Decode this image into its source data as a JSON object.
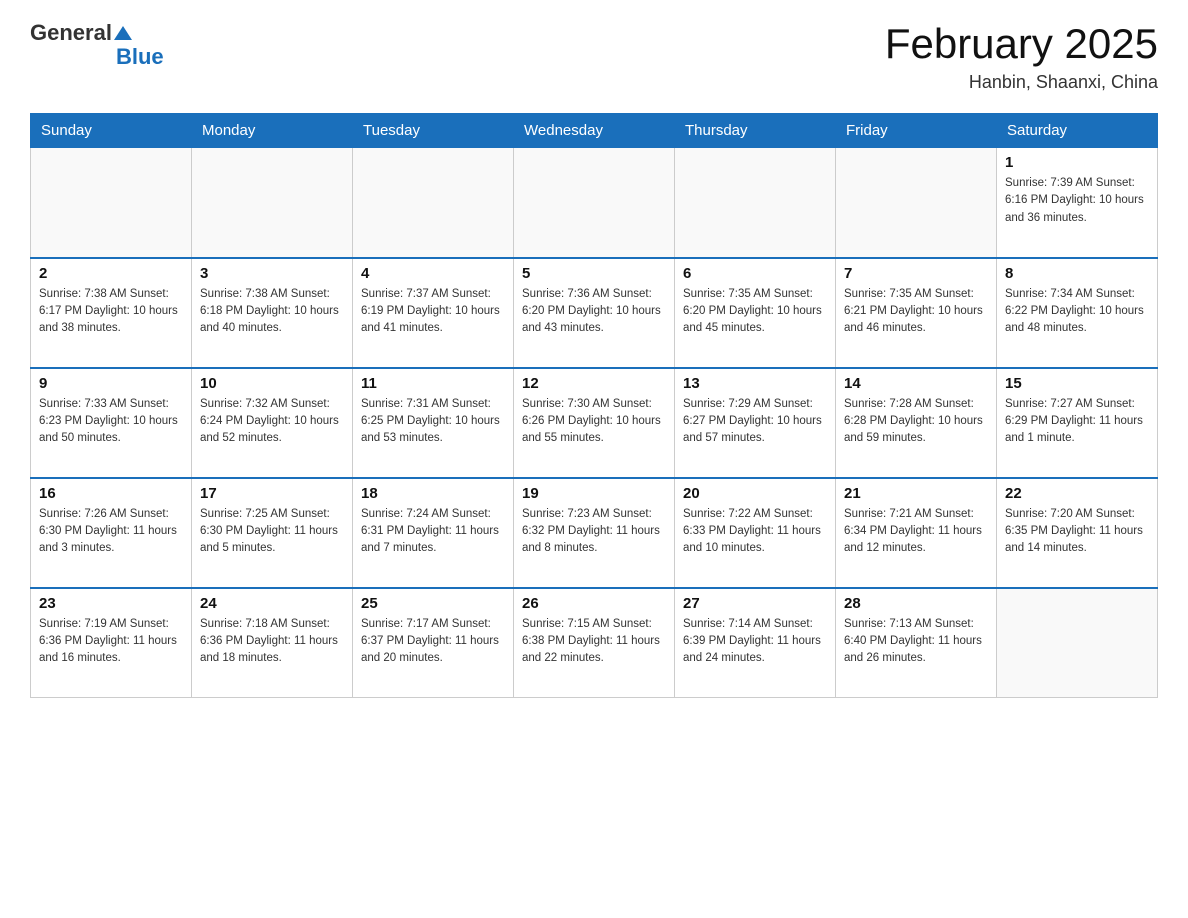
{
  "header": {
    "logo_general": "General",
    "logo_blue": "Blue",
    "month_title": "February 2025",
    "location": "Hanbin, Shaanxi, China"
  },
  "days_of_week": [
    "Sunday",
    "Monday",
    "Tuesday",
    "Wednesday",
    "Thursday",
    "Friday",
    "Saturday"
  ],
  "weeks": [
    [
      {
        "day": "",
        "info": ""
      },
      {
        "day": "",
        "info": ""
      },
      {
        "day": "",
        "info": ""
      },
      {
        "day": "",
        "info": ""
      },
      {
        "day": "",
        "info": ""
      },
      {
        "day": "",
        "info": ""
      },
      {
        "day": "1",
        "info": "Sunrise: 7:39 AM\nSunset: 6:16 PM\nDaylight: 10 hours and 36 minutes."
      }
    ],
    [
      {
        "day": "2",
        "info": "Sunrise: 7:38 AM\nSunset: 6:17 PM\nDaylight: 10 hours and 38 minutes."
      },
      {
        "day": "3",
        "info": "Sunrise: 7:38 AM\nSunset: 6:18 PM\nDaylight: 10 hours and 40 minutes."
      },
      {
        "day": "4",
        "info": "Sunrise: 7:37 AM\nSunset: 6:19 PM\nDaylight: 10 hours and 41 minutes."
      },
      {
        "day": "5",
        "info": "Sunrise: 7:36 AM\nSunset: 6:20 PM\nDaylight: 10 hours and 43 minutes."
      },
      {
        "day": "6",
        "info": "Sunrise: 7:35 AM\nSunset: 6:20 PM\nDaylight: 10 hours and 45 minutes."
      },
      {
        "day": "7",
        "info": "Sunrise: 7:35 AM\nSunset: 6:21 PM\nDaylight: 10 hours and 46 minutes."
      },
      {
        "day": "8",
        "info": "Sunrise: 7:34 AM\nSunset: 6:22 PM\nDaylight: 10 hours and 48 minutes."
      }
    ],
    [
      {
        "day": "9",
        "info": "Sunrise: 7:33 AM\nSunset: 6:23 PM\nDaylight: 10 hours and 50 minutes."
      },
      {
        "day": "10",
        "info": "Sunrise: 7:32 AM\nSunset: 6:24 PM\nDaylight: 10 hours and 52 minutes."
      },
      {
        "day": "11",
        "info": "Sunrise: 7:31 AM\nSunset: 6:25 PM\nDaylight: 10 hours and 53 minutes."
      },
      {
        "day": "12",
        "info": "Sunrise: 7:30 AM\nSunset: 6:26 PM\nDaylight: 10 hours and 55 minutes."
      },
      {
        "day": "13",
        "info": "Sunrise: 7:29 AM\nSunset: 6:27 PM\nDaylight: 10 hours and 57 minutes."
      },
      {
        "day": "14",
        "info": "Sunrise: 7:28 AM\nSunset: 6:28 PM\nDaylight: 10 hours and 59 minutes."
      },
      {
        "day": "15",
        "info": "Sunrise: 7:27 AM\nSunset: 6:29 PM\nDaylight: 11 hours and 1 minute."
      }
    ],
    [
      {
        "day": "16",
        "info": "Sunrise: 7:26 AM\nSunset: 6:30 PM\nDaylight: 11 hours and 3 minutes."
      },
      {
        "day": "17",
        "info": "Sunrise: 7:25 AM\nSunset: 6:30 PM\nDaylight: 11 hours and 5 minutes."
      },
      {
        "day": "18",
        "info": "Sunrise: 7:24 AM\nSunset: 6:31 PM\nDaylight: 11 hours and 7 minutes."
      },
      {
        "day": "19",
        "info": "Sunrise: 7:23 AM\nSunset: 6:32 PM\nDaylight: 11 hours and 8 minutes."
      },
      {
        "day": "20",
        "info": "Sunrise: 7:22 AM\nSunset: 6:33 PM\nDaylight: 11 hours and 10 minutes."
      },
      {
        "day": "21",
        "info": "Sunrise: 7:21 AM\nSunset: 6:34 PM\nDaylight: 11 hours and 12 minutes."
      },
      {
        "day": "22",
        "info": "Sunrise: 7:20 AM\nSunset: 6:35 PM\nDaylight: 11 hours and 14 minutes."
      }
    ],
    [
      {
        "day": "23",
        "info": "Sunrise: 7:19 AM\nSunset: 6:36 PM\nDaylight: 11 hours and 16 minutes."
      },
      {
        "day": "24",
        "info": "Sunrise: 7:18 AM\nSunset: 6:36 PM\nDaylight: 11 hours and 18 minutes."
      },
      {
        "day": "25",
        "info": "Sunrise: 7:17 AM\nSunset: 6:37 PM\nDaylight: 11 hours and 20 minutes."
      },
      {
        "day": "26",
        "info": "Sunrise: 7:15 AM\nSunset: 6:38 PM\nDaylight: 11 hours and 22 minutes."
      },
      {
        "day": "27",
        "info": "Sunrise: 7:14 AM\nSunset: 6:39 PM\nDaylight: 11 hours and 24 minutes."
      },
      {
        "day": "28",
        "info": "Sunrise: 7:13 AM\nSunset: 6:40 PM\nDaylight: 11 hours and 26 minutes."
      },
      {
        "day": "",
        "info": ""
      }
    ]
  ]
}
